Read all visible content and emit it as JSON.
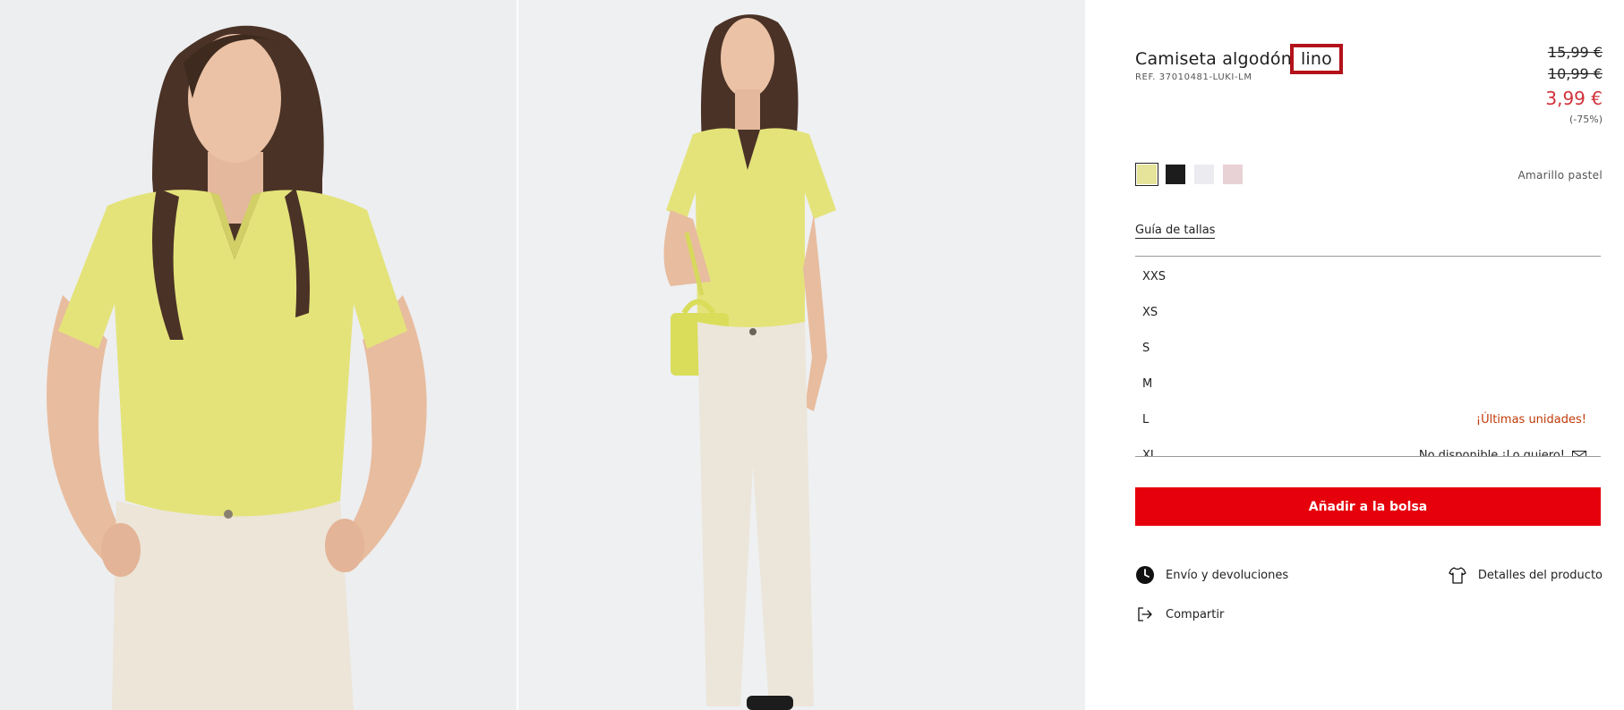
{
  "product": {
    "title": "Camiseta algodón",
    "title_highlight": "lino",
    "ref": "REF. 37010481-LUKI-LM",
    "price_original": "15,99 €",
    "price_previous": "10,99 €",
    "price_current": "3,99 €",
    "discount": "(-75%)"
  },
  "colors": {
    "selected_name": "Amarillo pastel",
    "swatches": [
      {
        "name": "amarillo",
        "hex": "#e6e39a"
      },
      {
        "name": "negro",
        "hex": "#1c1c1c"
      },
      {
        "name": "blanco",
        "hex": "#ebebf0"
      },
      {
        "name": "rosa",
        "hex": "#e8d2d6"
      }
    ]
  },
  "size_guide_label": "Guía de tallas",
  "sizes": [
    {
      "label": "XXS",
      "note": ""
    },
    {
      "label": "XS",
      "note": ""
    },
    {
      "label": "S",
      "note": ""
    },
    {
      "label": "M",
      "note": ""
    },
    {
      "label": "L",
      "note": "¡Últimas unidades!"
    },
    {
      "label": "XL",
      "note": "No disponible ¡Lo quiero!"
    }
  ],
  "add_to_bag_label": "Añadir a la bolsa",
  "links": {
    "shipping": "Envío y devoluciones",
    "details": "Detalles del producto",
    "share": "Compartir"
  },
  "accent_colors": {
    "buy_button": "#e5000b",
    "sale_price": "#d1313a",
    "last_units": "#c03a0a",
    "highlight_box": "#b3121a"
  }
}
